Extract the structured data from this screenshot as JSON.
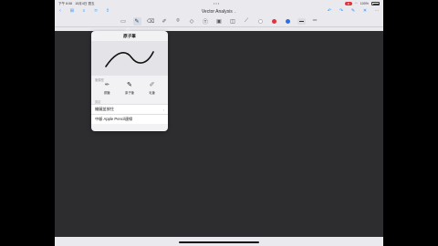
{
  "status_bar": {
    "time": "下午 6:06",
    "date": "10月4日 週五",
    "dots": "•••",
    "rec": "●",
    "battery": "100%"
  },
  "nav": {
    "title": "Vector Analysis",
    "title_chevron": "⌄",
    "left_icons": [
      "back-icon",
      "grid-icon",
      "search-icon",
      "bookmark-icon",
      "share-icon"
    ],
    "right_icons": [
      "undo-icon",
      "redo-icon",
      "pen-icon",
      "more-icon"
    ]
  },
  "toolbar": {
    "tools": [
      "read-mode-icon",
      "pen-icon",
      "eraser-icon",
      "highlighter-icon",
      "lasso-icon",
      "shapes-icon",
      "text-icon",
      "image-icon",
      "camera-icon",
      "laser-icon"
    ],
    "colors": [
      "#2b2b2b",
      "#e0333b",
      "#2d6fe6"
    ],
    "size_label": "—"
  },
  "popover": {
    "title": "原子筆",
    "section_pen_type": "筆類型",
    "pen_types": [
      {
        "label": "鋼筆",
        "icon": "fountain-pen-icon"
      },
      {
        "label": "原子筆",
        "icon": "ballpoint-pen-icon"
      },
      {
        "label": "毛筆",
        "icon": "brush-pen-icon"
      }
    ],
    "section_settings": "設定",
    "rows": [
      {
        "label": "繪圖並按住",
        "chevron": "›"
      },
      {
        "label": "中斷 Apple Pencil連線",
        "chevron": ""
      }
    ]
  }
}
